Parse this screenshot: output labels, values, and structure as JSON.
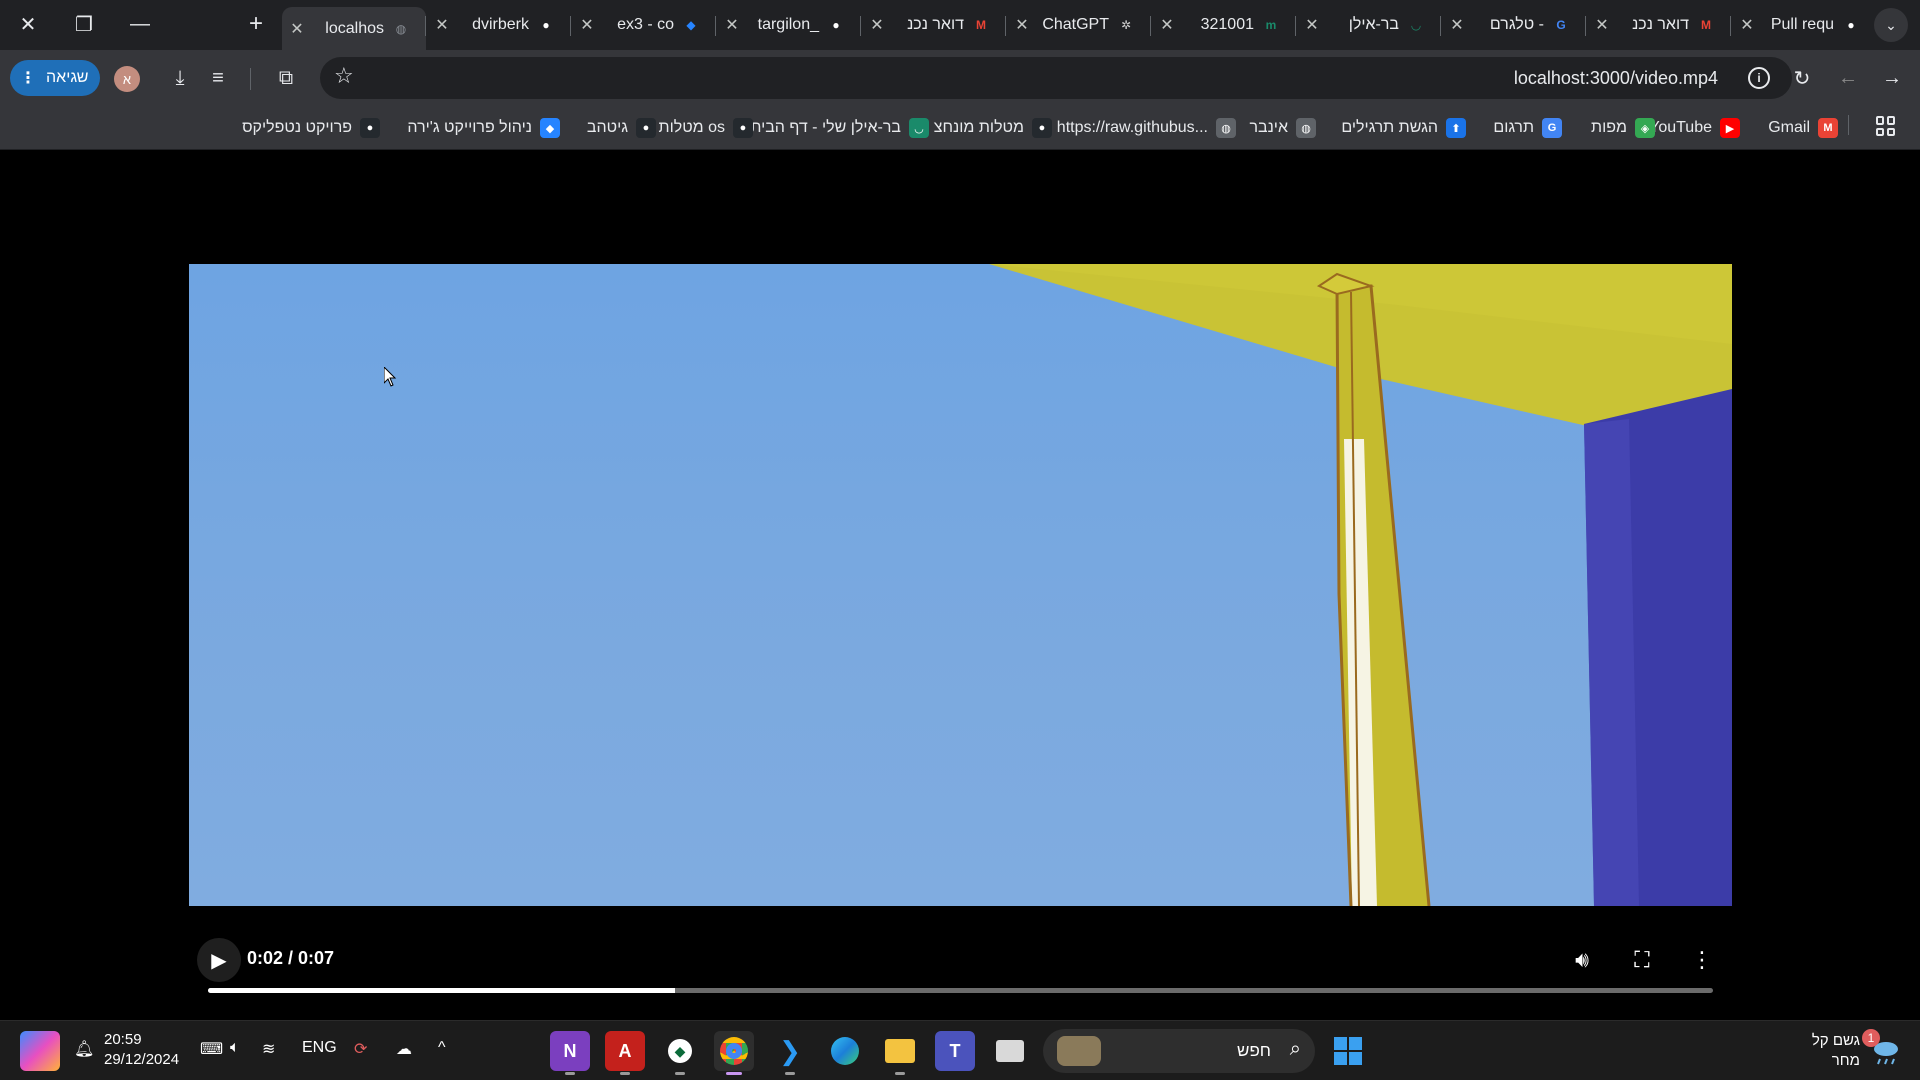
{
  "browser": {
    "tabs": [
      {
        "title": "localhos",
        "icon": "globe-icon",
        "active": true
      },
      {
        "title": "dvirberk",
        "icon": "github-icon"
      },
      {
        "title": "ex3 - co",
        "icon": "jira-icon"
      },
      {
        "title": "targilon_",
        "icon": "github-icon"
      },
      {
        "title": "דואר נכנ",
        "icon": "gmail-icon"
      },
      {
        "title": "ChatGPT",
        "icon": "chatgpt-icon"
      },
      {
        "title": "321001",
        "icon": "moodle-icon"
      },
      {
        "title": "בר-אילן",
        "icon": "biu-icon"
      },
      {
        "title": "טלגרם -",
        "icon": "google-icon"
      },
      {
        "title": "דואר נכנ",
        "icon": "gmail-icon"
      },
      {
        "title": "Pull requ",
        "icon": "github-icon"
      }
    ],
    "error_button_label": "שגיאה",
    "profile_initial": "א",
    "url": "localhost:3000/video.mp4",
    "bookmarks": [
      {
        "label": "Gmail",
        "icon": "gmail-icon",
        "color": "#ea4335"
      },
      {
        "label": "YouTube",
        "icon": "youtube-icon",
        "color": "#ff0000"
      },
      {
        "label": "מפות",
        "icon": "maps-icon",
        "color": "#34a853"
      },
      {
        "label": "תרגום",
        "icon": "translate-icon",
        "color": "#4285f4"
      },
      {
        "label": "הגשת תרגילים",
        "icon": "submit-icon",
        "color": "#1a73e8"
      },
      {
        "label": "אינבר",
        "icon": "globe-icon",
        "color": "#5f6368"
      },
      {
        "label": "https://raw.githubus...",
        "icon": "globe-icon",
        "color": "#5f6368"
      },
      {
        "label": "מטלות מונחצ",
        "icon": "github-icon",
        "color": "#24292e"
      },
      {
        "label": "בר-אילן שלי - דף הבית",
        "icon": "biu-icon",
        "color": "#1a8a6a"
      },
      {
        "label": "מטלות os",
        "icon": "github-icon",
        "color": "#24292e"
      },
      {
        "label": "גיטהב",
        "icon": "github-icon",
        "color": "#24292e"
      },
      {
        "label": "ניהול פרוייקט ג'ירה",
        "icon": "jira-icon",
        "color": "#2684ff"
      },
      {
        "label": "פרויקט נטפליקס",
        "icon": "github-icon",
        "color": "#24292e"
      }
    ]
  },
  "video": {
    "time_display": "0:02 / 0:07",
    "progress_fraction": 0.31
  },
  "taskbar": {
    "time": "20:59",
    "date": "29/12/2024",
    "language": "ENG",
    "search_placeholder": "חפש",
    "weather_line1": "גשם קל",
    "weather_line2": "מחר",
    "notification_count": "1"
  }
}
